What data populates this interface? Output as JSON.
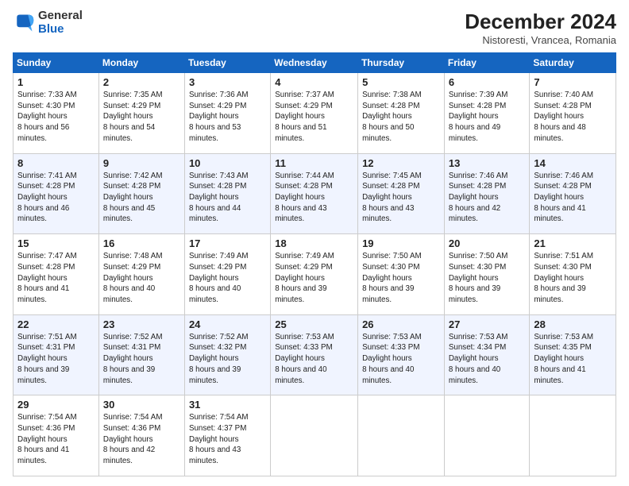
{
  "header": {
    "logo": {
      "general": "General",
      "blue": "Blue"
    },
    "month": "December 2024",
    "location": "Nistoresti, Vrancea, Romania"
  },
  "weekdays": [
    "Sunday",
    "Monday",
    "Tuesday",
    "Wednesday",
    "Thursday",
    "Friday",
    "Saturday"
  ],
  "weeks": [
    [
      {
        "day": "1",
        "sunrise": "7:33 AM",
        "sunset": "4:30 PM",
        "daylight": "8 hours and 56 minutes."
      },
      {
        "day": "2",
        "sunrise": "7:35 AM",
        "sunset": "4:29 PM",
        "daylight": "8 hours and 54 minutes."
      },
      {
        "day": "3",
        "sunrise": "7:36 AM",
        "sunset": "4:29 PM",
        "daylight": "8 hours and 53 minutes."
      },
      {
        "day": "4",
        "sunrise": "7:37 AM",
        "sunset": "4:29 PM",
        "daylight": "8 hours and 51 minutes."
      },
      {
        "day": "5",
        "sunrise": "7:38 AM",
        "sunset": "4:28 PM",
        "daylight": "8 hours and 50 minutes."
      },
      {
        "day": "6",
        "sunrise": "7:39 AM",
        "sunset": "4:28 PM",
        "daylight": "8 hours and 49 minutes."
      },
      {
        "day": "7",
        "sunrise": "7:40 AM",
        "sunset": "4:28 PM",
        "daylight": "8 hours and 48 minutes."
      }
    ],
    [
      {
        "day": "8",
        "sunrise": "7:41 AM",
        "sunset": "4:28 PM",
        "daylight": "8 hours and 46 minutes."
      },
      {
        "day": "9",
        "sunrise": "7:42 AM",
        "sunset": "4:28 PM",
        "daylight": "8 hours and 45 minutes."
      },
      {
        "day": "10",
        "sunrise": "7:43 AM",
        "sunset": "4:28 PM",
        "daylight": "8 hours and 44 minutes."
      },
      {
        "day": "11",
        "sunrise": "7:44 AM",
        "sunset": "4:28 PM",
        "daylight": "8 hours and 43 minutes."
      },
      {
        "day": "12",
        "sunrise": "7:45 AM",
        "sunset": "4:28 PM",
        "daylight": "8 hours and 43 minutes."
      },
      {
        "day": "13",
        "sunrise": "7:46 AM",
        "sunset": "4:28 PM",
        "daylight": "8 hours and 42 minutes."
      },
      {
        "day": "14",
        "sunrise": "7:46 AM",
        "sunset": "4:28 PM",
        "daylight": "8 hours and 41 minutes."
      }
    ],
    [
      {
        "day": "15",
        "sunrise": "7:47 AM",
        "sunset": "4:28 PM",
        "daylight": "8 hours and 41 minutes."
      },
      {
        "day": "16",
        "sunrise": "7:48 AM",
        "sunset": "4:29 PM",
        "daylight": "8 hours and 40 minutes."
      },
      {
        "day": "17",
        "sunrise": "7:49 AM",
        "sunset": "4:29 PM",
        "daylight": "8 hours and 40 minutes."
      },
      {
        "day": "18",
        "sunrise": "7:49 AM",
        "sunset": "4:29 PM",
        "daylight": "8 hours and 39 minutes."
      },
      {
        "day": "19",
        "sunrise": "7:50 AM",
        "sunset": "4:30 PM",
        "daylight": "8 hours and 39 minutes."
      },
      {
        "day": "20",
        "sunrise": "7:50 AM",
        "sunset": "4:30 PM",
        "daylight": "8 hours and 39 minutes."
      },
      {
        "day": "21",
        "sunrise": "7:51 AM",
        "sunset": "4:30 PM",
        "daylight": "8 hours and 39 minutes."
      }
    ],
    [
      {
        "day": "22",
        "sunrise": "7:51 AM",
        "sunset": "4:31 PM",
        "daylight": "8 hours and 39 minutes."
      },
      {
        "day": "23",
        "sunrise": "7:52 AM",
        "sunset": "4:31 PM",
        "daylight": "8 hours and 39 minutes."
      },
      {
        "day": "24",
        "sunrise": "7:52 AM",
        "sunset": "4:32 PM",
        "daylight": "8 hours and 39 minutes."
      },
      {
        "day": "25",
        "sunrise": "7:53 AM",
        "sunset": "4:33 PM",
        "daylight": "8 hours and 40 minutes."
      },
      {
        "day": "26",
        "sunrise": "7:53 AM",
        "sunset": "4:33 PM",
        "daylight": "8 hours and 40 minutes."
      },
      {
        "day": "27",
        "sunrise": "7:53 AM",
        "sunset": "4:34 PM",
        "daylight": "8 hours and 40 minutes."
      },
      {
        "day": "28",
        "sunrise": "7:53 AM",
        "sunset": "4:35 PM",
        "daylight": "8 hours and 41 minutes."
      }
    ],
    [
      {
        "day": "29",
        "sunrise": "7:54 AM",
        "sunset": "4:36 PM",
        "daylight": "8 hours and 41 minutes."
      },
      {
        "day": "30",
        "sunrise": "7:54 AM",
        "sunset": "4:36 PM",
        "daylight": "8 hours and 42 minutes."
      },
      {
        "day": "31",
        "sunrise": "7:54 AM",
        "sunset": "4:37 PM",
        "daylight": "8 hours and 43 minutes."
      },
      null,
      null,
      null,
      null
    ]
  ],
  "labels": {
    "sunrise": "Sunrise:",
    "sunset": "Sunset:",
    "daylight": "Daylight hours"
  }
}
